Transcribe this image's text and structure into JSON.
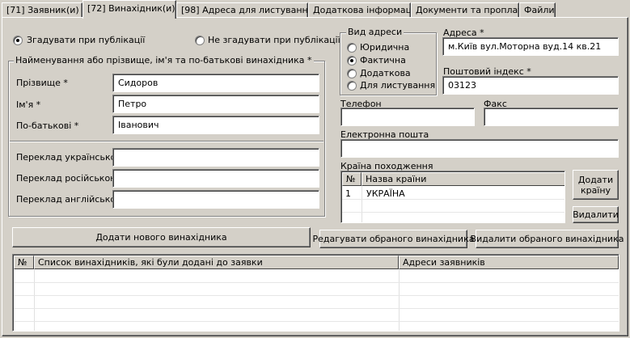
{
  "tabs": [
    {
      "label": "[71] Заявник(и) *",
      "active": false
    },
    {
      "label": "[72] Винахідник(и) *",
      "active": true
    },
    {
      "label": "[98] Адреса для листування *",
      "active": false
    },
    {
      "label": "Додаткова інформація",
      "active": false
    },
    {
      "label": "Документи та проплати",
      "active": false
    },
    {
      "label": "Файли",
      "active": false
    }
  ],
  "mention": {
    "mention_label": "Згадувати при публікації",
    "no_mention_label": "Не згадувати при публікації",
    "selected": "mention"
  },
  "name_group": {
    "title": "Найменування або прізвище, ім'я та по-батькові винахідника *",
    "surname_label": "Прізвище *",
    "surname_value": "Сидоров",
    "firstname_label": "Ім'я *",
    "firstname_value": "Петро",
    "patronymic_label": "По-батькові *",
    "patronymic_value": "Іванович",
    "translation_ua_label": "Переклад українською",
    "translation_ua_value": "",
    "translation_ru_label": "Переклад російською",
    "translation_ru_value": "",
    "translation_en_label": "Переклад англійською",
    "translation_en_value": ""
  },
  "address_type": {
    "title": "Вид адреси",
    "options": [
      "Юридична",
      "Фактична",
      "Додаткова",
      "Для листування"
    ],
    "selected_index": 1
  },
  "address": {
    "address_label": "Адреса *",
    "address_value": "м.Київ вул.Моторна вуд.14 кв.21",
    "postcode_label": "Поштовий індекс *",
    "postcode_value": "03123",
    "phone_label": "Телефон",
    "phone_value": "",
    "fax_label": "Факс",
    "fax_value": "",
    "email_label": "Електронна пошта",
    "email_value": ""
  },
  "country": {
    "title": "Країна походження",
    "columns": [
      "№",
      "Назва країни"
    ],
    "rows": [
      {
        "num": "1",
        "name": "УКРАЇНА"
      }
    ],
    "add_label": "Додати країну",
    "delete_label": "Видалити"
  },
  "actions": {
    "add_inventor_label": "Додати нового винахідника",
    "edit_inventor_label": "Редагувати обраного винахідника",
    "delete_inventor_label": "Видалити обраного винахідника"
  },
  "inventors_table": {
    "columns": [
      "№",
      "Список винахідників, які були додані до заявки",
      "Адреси заявників"
    ],
    "rows": []
  }
}
